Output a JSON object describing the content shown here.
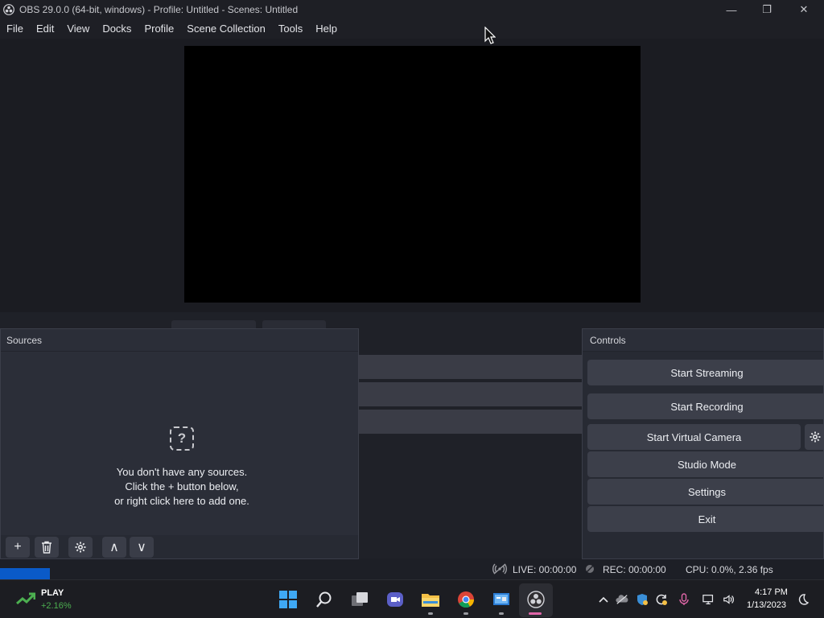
{
  "window": {
    "title": "OBS 29.0.0 (64-bit, windows) - Profile: Untitled - Scenes: Untitled",
    "minimize_glyph": "—",
    "restore_glyph": "❐",
    "close_glyph": "✕"
  },
  "menu": [
    "File",
    "Edit",
    "View",
    "Docks",
    "Profile",
    "Scene Collection",
    "Tools",
    "Help"
  ],
  "sources": {
    "title": "Sources",
    "empty_icon_glyph": "?",
    "empty_lines": [
      "You don't have any sources.",
      "Click the + button below,",
      "or right click here to add one."
    ],
    "toolbar": {
      "add": "+",
      "up": "∧",
      "down": "∨"
    }
  },
  "controls": {
    "title": "Controls",
    "start_streaming": "Start Streaming",
    "start_recording": "Start Recording",
    "start_virtual_camera": "Start Virtual Camera",
    "studio_mode": "Studio Mode",
    "settings": "Settings",
    "exit": "Exit"
  },
  "status": {
    "live": "LIVE: 00:00:00",
    "rec": "REC: 00:00:00",
    "cpu": "CPU: 0.0%, 2.36 fps"
  },
  "taskbar": {
    "widget_label": "PLAY",
    "widget_change": "+2.16%",
    "widget_color": "#4caf50",
    "time": "4:17 PM",
    "date": "1/13/2023"
  },
  "colors": {
    "accent": "#0a5ac8",
    "taskbar_indicator": "#e066a8"
  }
}
